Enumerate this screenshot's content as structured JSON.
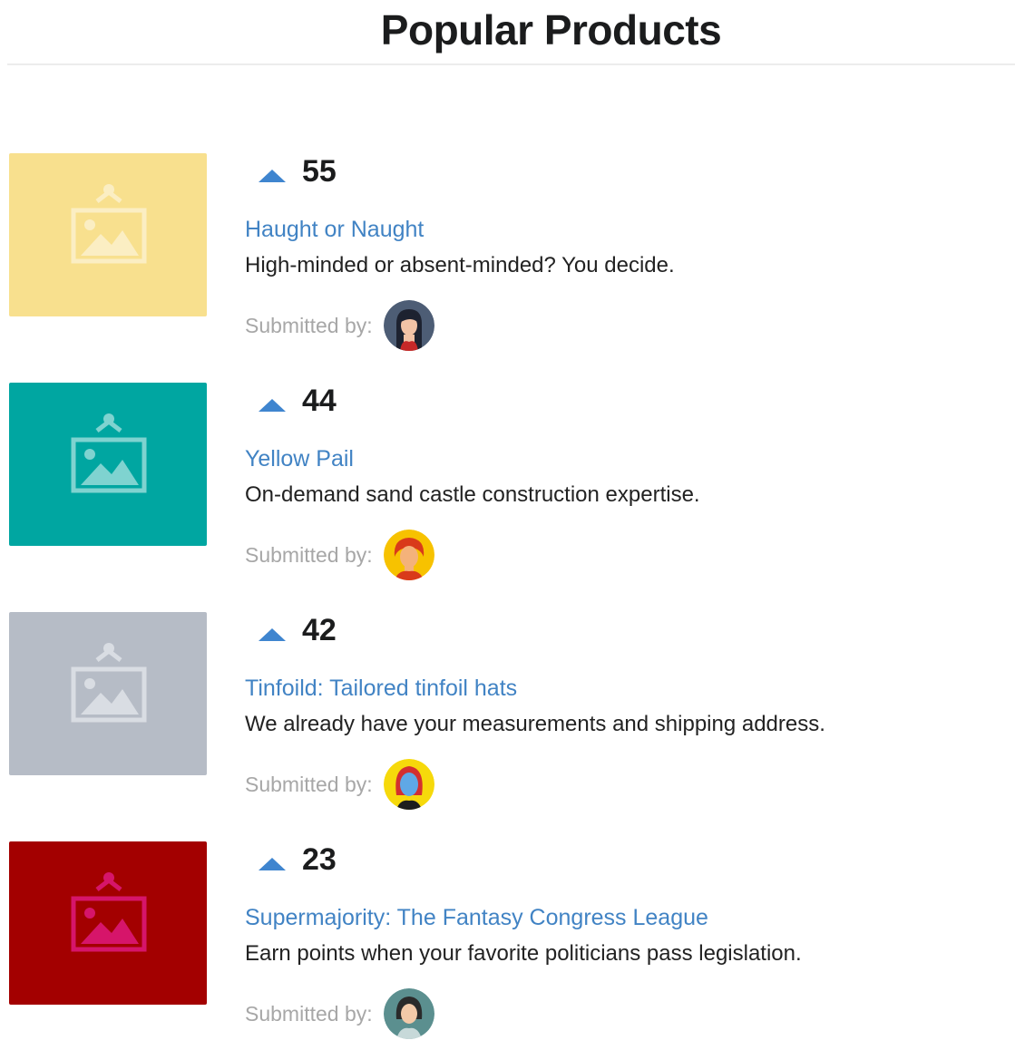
{
  "page": {
    "title": "Popular Products"
  },
  "submitted_label": "Submitted by:",
  "products": [
    {
      "votes": "55",
      "title": "Haught or Naught",
      "description": "High-minded or absent-minded? You decide.",
      "thumb_color": "#f8e08e",
      "icon": "image-placeholder-icon",
      "avatar": "woman-dark-hair-avatar"
    },
    {
      "votes": "44",
      "title": "Yellow Pail",
      "description": "On-demand sand castle construction expertise.",
      "thumb_color": "#00a6a1",
      "icon": "image-placeholder-icon",
      "avatar": "red-hair-avatar"
    },
    {
      "votes": "42",
      "title": "Tinfoild: Tailored tinfoil hats",
      "description": "We already have your measurements and shipping address.",
      "thumb_color": "#b6bcc6",
      "icon": "image-placeholder-icon",
      "avatar": "red-hair-blue-face-avatar"
    },
    {
      "votes": "23",
      "title": "Supermajority: The Fantasy Congress League",
      "description": "Earn points when your favorite politicians pass legislation.",
      "thumb_color": "#a30000",
      "icon": "image-placeholder-icon",
      "avatar": "teal-avatar"
    }
  ]
}
